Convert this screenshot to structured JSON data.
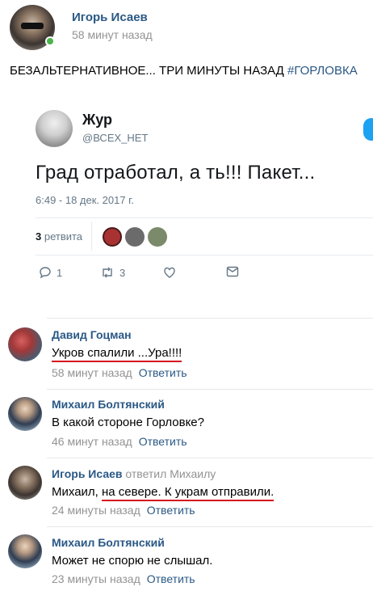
{
  "post": {
    "author": "Игорь Исаев",
    "time": "58 минут назад",
    "text_main": "БЕЗАЛЬТЕРНАТИВНОЕ... ТРИ МИНУТЫ НАЗАД ",
    "hashtag": "#ГОРЛОВКА"
  },
  "tweet": {
    "name": "Жур",
    "handle": "@ВСЕХ_НЕТ",
    "text": "Град отработал, а​ ть!!! Пакет...",
    "date": "6:49 - 18 дек. 2017 г.",
    "retweet_count": "3",
    "retweet_label": " ретвита",
    "replies": "1",
    "retweets": "3",
    "colors": {
      "rt_avatar_1": "#a83232",
      "rt_avatar_2": "#6b6b6b",
      "rt_avatar_3": "#7a8a6a"
    }
  },
  "comments": [
    {
      "author": "Давид Гоцман",
      "reply_to": "",
      "text_plain": "",
      "text_underlined": "Укров спалили ...Ура!!!!",
      "time": "58 минут назад",
      "reply_label": "Ответить"
    },
    {
      "author": "Михаил Болтянский",
      "reply_to": "",
      "text_plain": "В какой стороне Горловке?",
      "text_underlined": "",
      "time": "46 минут назад",
      "reply_label": "Ответить"
    },
    {
      "author": "Игорь Исаев",
      "reply_to": "ответил Михаилу",
      "text_plain": "Михаил, ",
      "text_underlined": "на севере. К украм отправили.",
      "time": "24 минуты назад",
      "reply_label": "Ответить"
    },
    {
      "author": "Михаил Болтянский",
      "reply_to": "",
      "text_plain": "Может не спорю не слышал.",
      "text_underlined": "",
      "time": "23 минуты назад",
      "reply_label": "Ответить"
    }
  ],
  "colors": {
    "link": "#2a5885",
    "meta": "#939393",
    "online": "#4bb34b",
    "underline": "#d5161e"
  }
}
